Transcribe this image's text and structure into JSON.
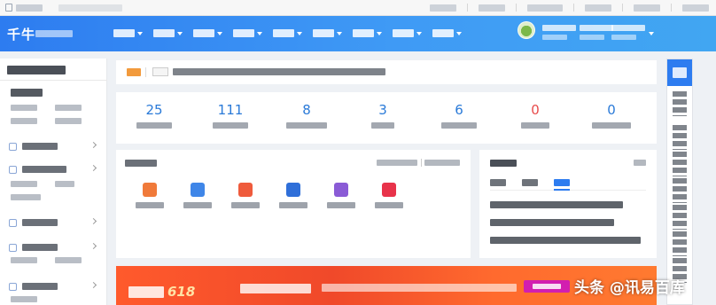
{
  "app": {
    "brand": "千牛"
  },
  "topbar": {
    "links": [
      "",
      "",
      "",
      "",
      "",
      ""
    ]
  },
  "navbar": {
    "menu": [
      "",
      "",
      "",
      "",
      "",
      "",
      "",
      "",
      ""
    ]
  },
  "stats": [
    {
      "value": "25",
      "label": "",
      "highlight": "blue"
    },
    {
      "value": "111",
      "label": "",
      "highlight": "blue"
    },
    {
      "value": "8",
      "label": "",
      "highlight": "blue"
    },
    {
      "value": "3",
      "label": "",
      "highlight": "blue"
    },
    {
      "value": "6",
      "label": "",
      "highlight": "blue"
    },
    {
      "value": "0",
      "label": "",
      "highlight": "red"
    },
    {
      "value": "0",
      "label": "",
      "highlight": "blue"
    }
  ],
  "quick_icons": [
    {
      "label": "",
      "color": "#f07a3a"
    },
    {
      "label": "",
      "color": "#3f86e8"
    },
    {
      "label": "",
      "color": "#ef5b3c"
    },
    {
      "label": "",
      "color": "#2f6fd9"
    },
    {
      "label": "",
      "color": "#8a5bd6"
    },
    {
      "label": "",
      "color": "#e8334a"
    }
  ],
  "banner": {
    "number": "618"
  },
  "watermark": "头条 @讯易百库",
  "colors": {
    "primary": "#2d7cf0",
    "red_stat": "#e84b4b",
    "banner": "#f0492a",
    "banner_button": "#d21eb0"
  }
}
